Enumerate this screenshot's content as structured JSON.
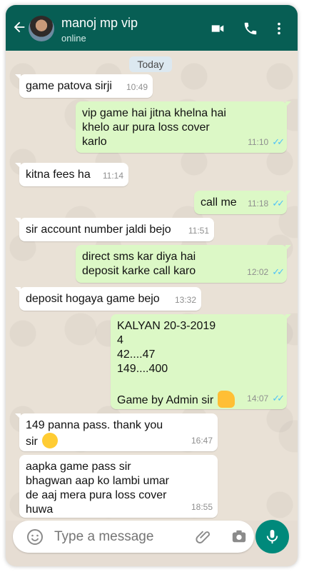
{
  "header": {
    "contact_name": "manoj mp vip",
    "status": "online",
    "icons": [
      "back-arrow-icon",
      "video-call-icon",
      "phone-icon",
      "more-options-icon"
    ]
  },
  "chat": {
    "date_separator": "Today",
    "messages": [
      {
        "direction": "incoming",
        "text": "game patova sirji",
        "time": "10:49"
      },
      {
        "direction": "outgoing",
        "text": "vip game hai jitna khelna hai\nkhelo aur pura loss cover\nkarlo",
        "time": "11:10",
        "ticks": "✓✓"
      },
      {
        "direction": "incoming",
        "text": "kitna fees ha",
        "time": "11:14"
      },
      {
        "direction": "outgoing",
        "text": "call me",
        "time": "11:18",
        "ticks": "✓✓"
      },
      {
        "direction": "incoming",
        "text": "sir account number jaldi bejo",
        "time": "11:51"
      },
      {
        "direction": "outgoing",
        "text": "direct sms kar diya hai\ndeposit karke call karo",
        "time": "12:02",
        "ticks": "✓✓"
      },
      {
        "direction": "incoming",
        "text": "deposit hogaya game bejo",
        "time": "13:32"
      },
      {
        "direction": "outgoing",
        "text": "KALYAN 20-3-2019\n4\n42....47\n149....400\n\nGame by Admin sir",
        "time": "14:07",
        "ticks": "✓✓",
        "emoji": "thumbs-up-emoji"
      },
      {
        "direction": "incoming",
        "text": "149 panna pass. thank you\nsir",
        "time": "16:47",
        "emoji": "kiss-face-emoji"
      },
      {
        "direction": "incoming",
        "text": "aapka game pass sir\nbhagwan aap ko lambi umar\nde aaj mera pura loss cover\nhuwa",
        "time": "18:55"
      }
    ]
  },
  "composer": {
    "placeholder": "Type a message",
    "icons": [
      "emoji-icon",
      "attach-icon",
      "camera-icon",
      "mic-icon"
    ]
  },
  "colors": {
    "header": "#075e54",
    "outgoing_bubble": "#dcf8c6",
    "incoming_bubble": "#ffffff",
    "read_ticks": "#4fc3f7",
    "mic_button": "#00897b"
  }
}
